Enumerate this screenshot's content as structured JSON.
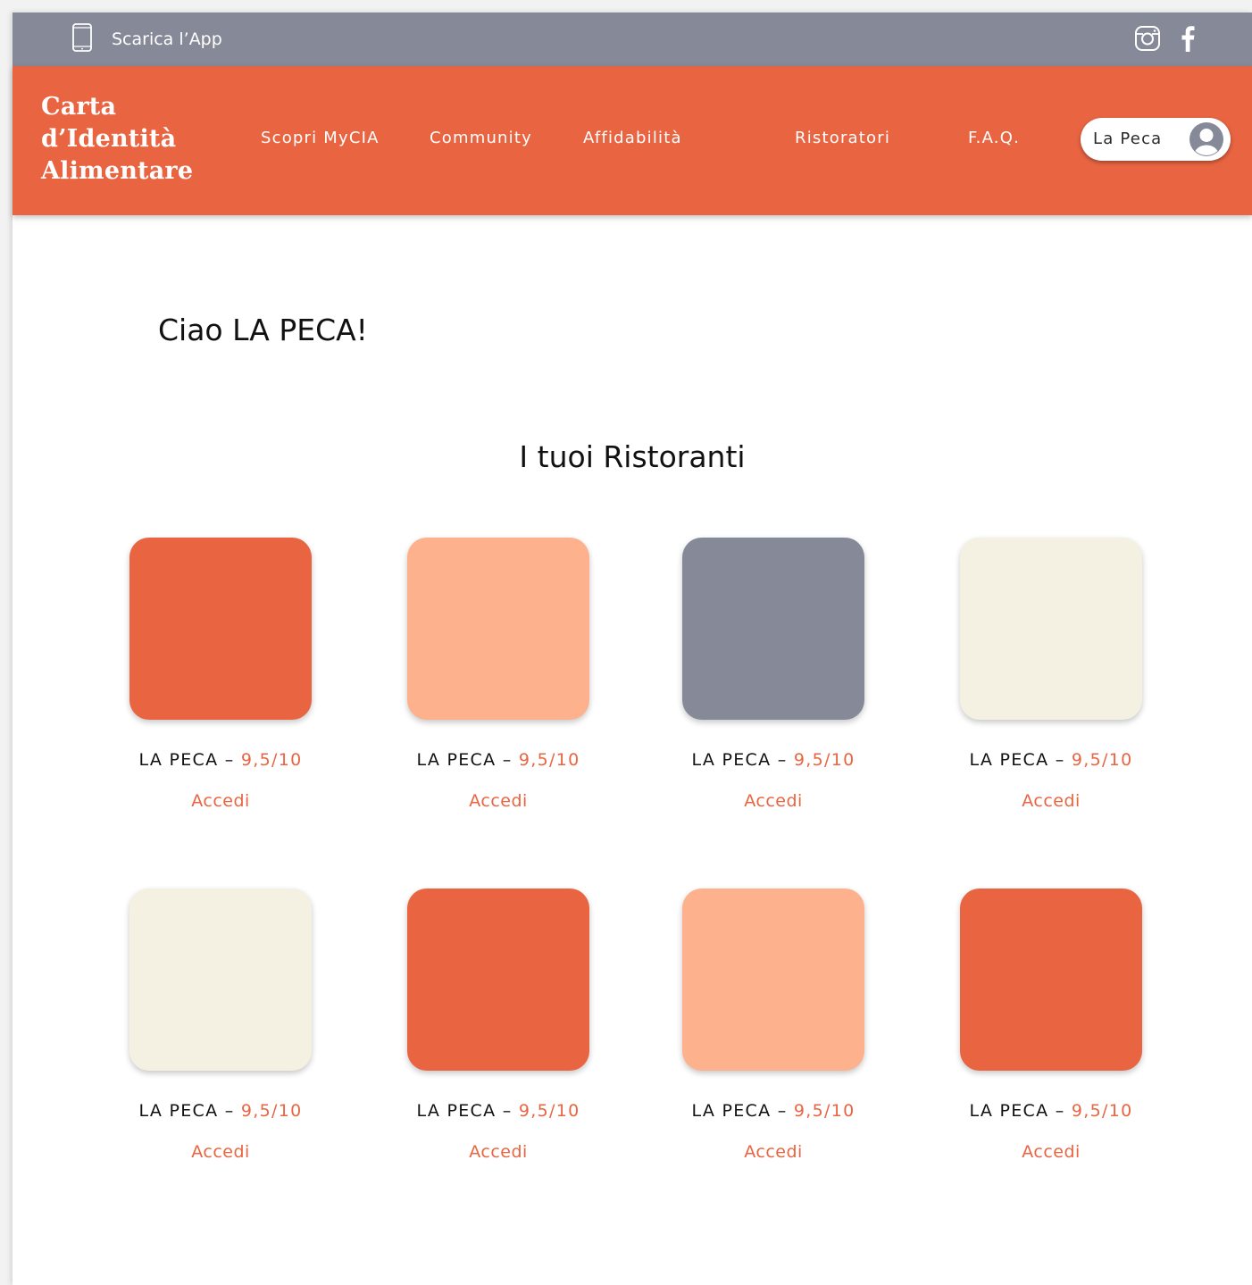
{
  "topbar": {
    "app_label": "Scarica l’App",
    "phone_icon": "phone-icon",
    "social": [
      "instagram-icon",
      "facebook-icon"
    ]
  },
  "header": {
    "brand_line1": "Carta",
    "brand_line2": "d’Identità",
    "brand_line3": "Alimentare",
    "nav": [
      "Scopri MyCIA",
      "Community",
      "Affidabilità",
      "Ristoratori",
      "F.A.Q."
    ],
    "user_name": "La Peca"
  },
  "main": {
    "greeting": "Ciao LA PECA!",
    "section_title": "I tuoi Ristoranti",
    "restaurants": [
      {
        "name": "LA PECA",
        "separator": " – ",
        "score": "9,5/10",
        "action": "Accedi",
        "color": "#e96542"
      },
      {
        "name": "LA PECA",
        "separator": " – ",
        "score": "9,5/10",
        "action": "Accedi",
        "color": "#fdb28d"
      },
      {
        "name": "LA PECA",
        "separator": " – ",
        "score": "9,5/10",
        "action": "Accedi",
        "color": "#868a98"
      },
      {
        "name": "LA PECA",
        "separator": " – ",
        "score": "9,5/10",
        "action": "Accedi",
        "color": "#f4f1e3"
      },
      {
        "name": "LA PECA",
        "separator": " – ",
        "score": "9,5/10",
        "action": "Accedi",
        "color": "#f4f1e3"
      },
      {
        "name": "LA PECA",
        "separator": " – ",
        "score": "9,5/10",
        "action": "Accedi",
        "color": "#e96542"
      },
      {
        "name": "LA PECA",
        "separator": " – ",
        "score": "9,5/10",
        "action": "Accedi",
        "color": "#fdb28d"
      },
      {
        "name": "LA PECA",
        "separator": " – ",
        "score": "9,5/10",
        "action": "Accedi",
        "color": "#e96542"
      }
    ]
  },
  "colors": {
    "accent": "#e96542",
    "topbar": "#868a98",
    "peach": "#fdb28d",
    "cream": "#f4f1e3"
  }
}
